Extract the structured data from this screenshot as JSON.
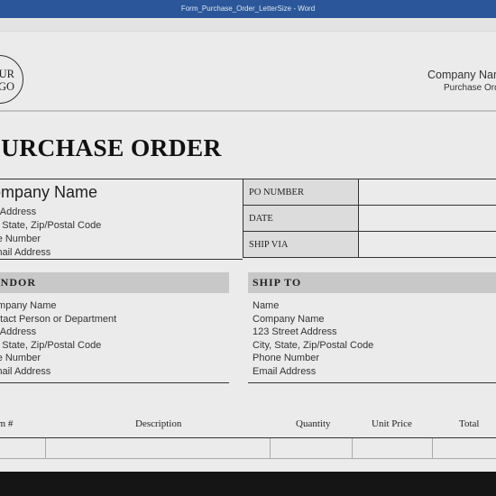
{
  "window": {
    "title": "Form_Purchase_Order_LetterSize  -  Word"
  },
  "header": {
    "logo_lines": [
      "UR",
      "GO"
    ],
    "company_name": "Company Name",
    "document_label": "Purchase Order"
  },
  "document": {
    "title": "PURCHASE ORDER",
    "company": {
      "name": "Company Name",
      "lines": [
        "Street Address",
        "City, State, Zip/Postal Code",
        "Phone Number",
        "Email Address"
      ]
    },
    "info_fields": [
      {
        "label": "PO NUMBER",
        "value": ""
      },
      {
        "label": "DATE",
        "value": ""
      },
      {
        "label": "SHIP VIA",
        "value": ""
      }
    ],
    "vendor": {
      "heading": "VENDOR",
      "lines": [
        "Company Name",
        "Contact Person or Department",
        "Street Address",
        "City, State, Zip/Postal Code",
        "Phone Number",
        "Email Address"
      ]
    },
    "ship_to": {
      "heading": "SHIP TO",
      "lines": [
        "Name",
        "Company Name",
        "123 Street Address",
        "City, State, Zip/Postal Code",
        "Phone Number",
        "Email Address"
      ]
    },
    "items": {
      "columns": [
        "Item #",
        "Description",
        "Quantity",
        "Unit Price",
        "Total"
      ]
    }
  }
}
